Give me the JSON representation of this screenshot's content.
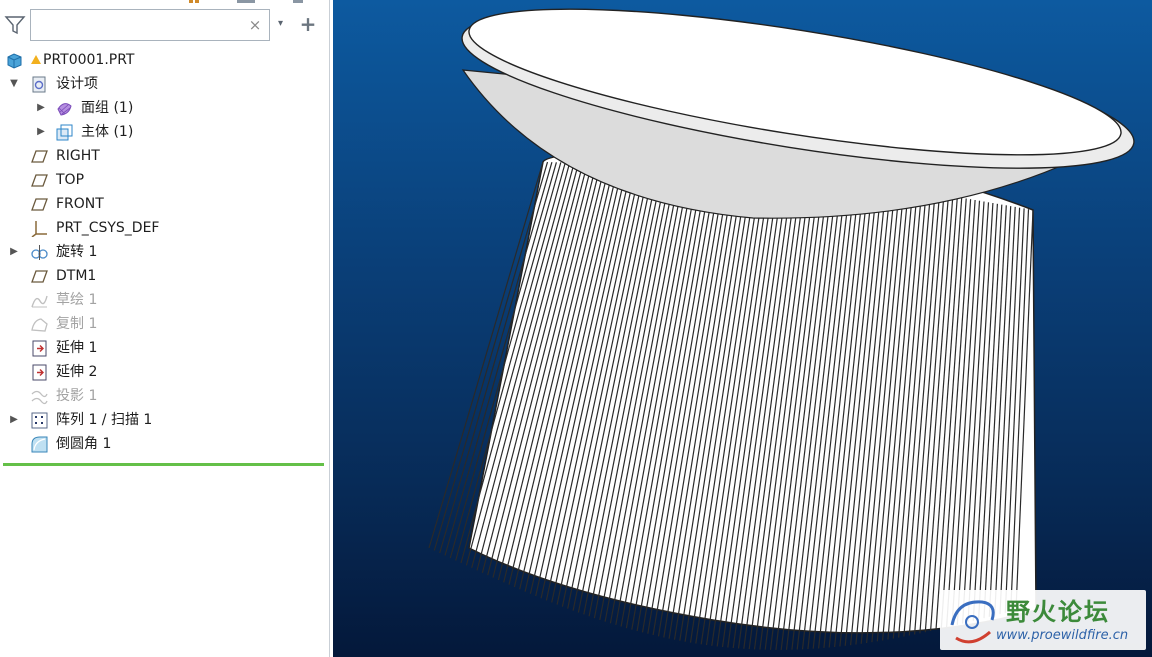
{
  "search": {
    "value": "",
    "placeholder": ""
  },
  "toolbar": {
    "clear_label": "×",
    "dropdown_label": "▾",
    "add_label": "+"
  },
  "tree": {
    "items": [
      {
        "label": "PRT0001.PRT",
        "icon": "part-icon",
        "arrow": "",
        "dim": false
      },
      {
        "label": "设计项",
        "icon": "design-items-icon",
        "arrow": "▼",
        "dim": false
      },
      {
        "label": "面组 (1)",
        "icon": "quilt-icon",
        "arrow": "▶",
        "dim": false
      },
      {
        "label": "主体 (1)",
        "icon": "body-icon",
        "arrow": "▶",
        "dim": false
      },
      {
        "label": "RIGHT",
        "icon": "datum-plane-icon",
        "arrow": "",
        "dim": false
      },
      {
        "label": "TOP",
        "icon": "datum-plane-icon",
        "arrow": "",
        "dim": false
      },
      {
        "label": "FRONT",
        "icon": "datum-plane-icon",
        "arrow": "",
        "dim": false
      },
      {
        "label": "PRT_CSYS_DEF",
        "icon": "csys-icon",
        "arrow": "",
        "dim": false
      },
      {
        "label": "旋转 1",
        "icon": "revolve-icon",
        "arrow": "▶",
        "dim": false
      },
      {
        "label": "DTM1",
        "icon": "datum-plane-icon",
        "arrow": "",
        "dim": false
      },
      {
        "label": "草绘 1",
        "icon": "sketch-icon",
        "arrow": "",
        "dim": true
      },
      {
        "label": "复制 1",
        "icon": "copy-icon",
        "arrow": "",
        "dim": true
      },
      {
        "label": "延伸 1",
        "icon": "extend-icon",
        "arrow": "",
        "dim": false
      },
      {
        "label": "延伸 2",
        "icon": "extend-icon",
        "arrow": "",
        "dim": false
      },
      {
        "label": "投影 1",
        "icon": "project-icon",
        "arrow": "",
        "dim": true
      },
      {
        "label": "阵列 1 / 扫描 1",
        "icon": "pattern-icon",
        "arrow": "▶",
        "dim": false
      },
      {
        "label": "倒圆角 1",
        "icon": "round-icon",
        "arrow": "",
        "dim": false
      }
    ]
  },
  "watermark": {
    "title": "野火论坛",
    "url": "www.proewildfire.cn"
  },
  "colors": {
    "viewport_top": "#0d5aa0",
    "viewport_bottom": "#04183a",
    "tree_end_line": "#64c048"
  }
}
